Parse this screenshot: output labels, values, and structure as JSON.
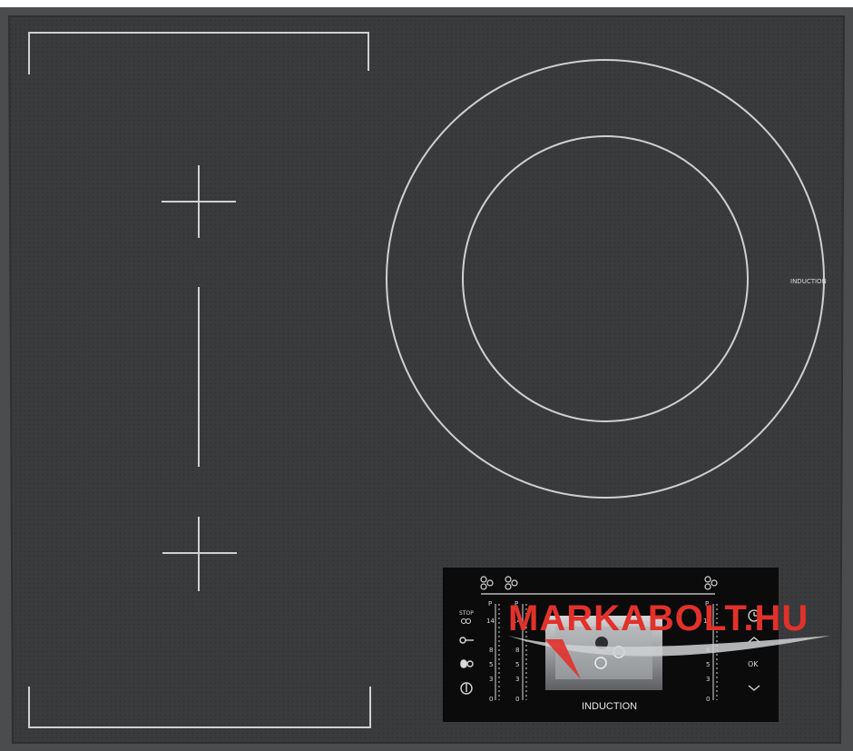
{
  "hob": {
    "zone_label": "INDUCTION",
    "panel_label": "INDUCTION",
    "watermark": "MARKABOLT.HU",
    "controls": {
      "stop_label": "STOP",
      "ok_label": "OK",
      "scale_top": "P",
      "scale_14": "14",
      "scale_8": "8",
      "scale_5": "5",
      "scale_3": "3",
      "scale_0": "0"
    },
    "colors": {
      "glass": "#3a3b3d",
      "frame": "#4b4c4e",
      "panel": "#0b0b0c",
      "lines": "#cfd0d2",
      "watermark": "#e2312b"
    }
  }
}
